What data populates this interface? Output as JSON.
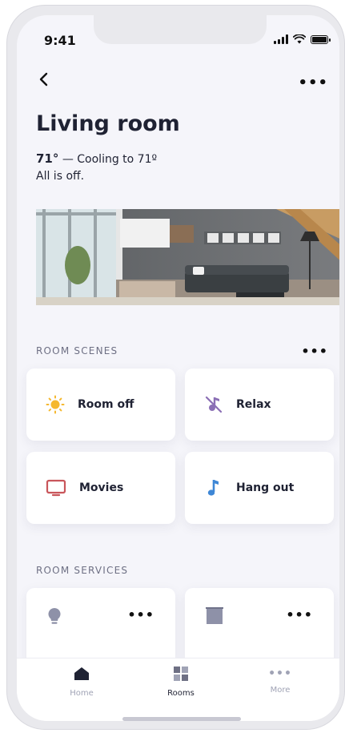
{
  "status_bar": {
    "time": "9:41"
  },
  "header": {
    "title": "Living room"
  },
  "climate": {
    "temperature": "71°",
    "status": " — Cooling to 71º",
    "summary": "All is off."
  },
  "scenes": {
    "heading": "ROOM SCENES",
    "items": [
      {
        "label": "Room off",
        "icon": "sun-icon",
        "color": "#f5b82e"
      },
      {
        "label": "Relax",
        "icon": "no-music-icon",
        "color": "#8b6fb5"
      },
      {
        "label": "Movies",
        "icon": "tv-icon",
        "color": "#c9565b"
      },
      {
        "label": "Hang out",
        "icon": "music-note-icon",
        "color": "#3e87d6"
      }
    ]
  },
  "services": {
    "heading": "ROOM SERVICES",
    "items": [
      {
        "icon": "lightbulb-icon"
      },
      {
        "icon": "blinds-icon"
      }
    ]
  },
  "tabbar": {
    "items": [
      {
        "label": "Home",
        "icon": "home-icon",
        "active": false
      },
      {
        "label": "Rooms",
        "icon": "grid-icon",
        "active": true
      },
      {
        "label": "More",
        "icon": "more-dots-icon",
        "active": false
      }
    ]
  },
  "colors": {
    "accent": "#1f2233",
    "muted": "#a0a3b5",
    "background": "#f5f5fa"
  }
}
